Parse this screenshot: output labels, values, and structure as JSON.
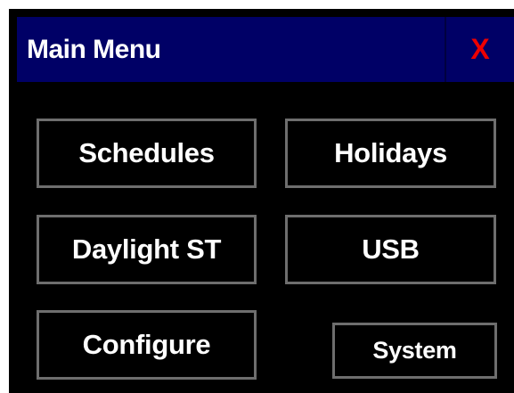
{
  "window": {
    "title": "Main Menu",
    "close_label": "X",
    "title_bar_color": "#000066",
    "close_color": "#ee0000",
    "background_color": "#000000",
    "button_border_color": "#6e6e6e"
  },
  "menu": {
    "schedules": "Schedules",
    "holidays": "Holidays",
    "daylight_st": "Daylight ST",
    "usb": "USB",
    "configure": "Configure",
    "system": "System"
  }
}
